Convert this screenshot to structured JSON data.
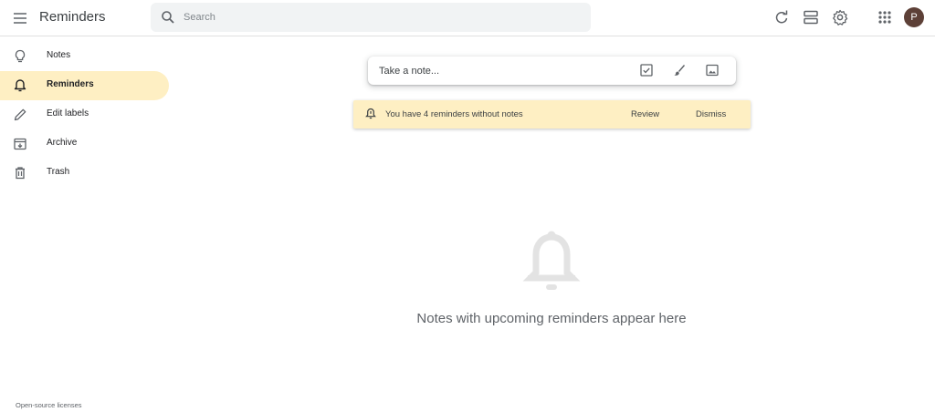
{
  "header": {
    "title": "Reminders",
    "search_placeholder": "Search",
    "avatar_initial": "P"
  },
  "sidebar": {
    "items": [
      {
        "label": "Notes",
        "icon": "lightbulb-icon",
        "active": false
      },
      {
        "label": "Reminders",
        "icon": "bell-icon",
        "active": true
      },
      {
        "label": "Edit labels",
        "icon": "pencil-icon",
        "active": false
      },
      {
        "label": "Archive",
        "icon": "archive-icon",
        "active": false
      },
      {
        "label": "Trash",
        "icon": "trash-icon",
        "active": false
      }
    ],
    "footer_link": "Open-source licenses"
  },
  "note_input": {
    "placeholder": "Take a note...",
    "icons": [
      "checkbox-icon",
      "brush-icon",
      "image-icon"
    ]
  },
  "banner": {
    "text": "You have 4 reminders without notes",
    "review_label": "Review",
    "dismiss_label": "Dismiss"
  },
  "empty_state": {
    "text": "Notes with upcoming reminders appear here",
    "icon": "bell-icon"
  },
  "colors": {
    "active_bg": "#feefc3",
    "banner_bg": "#feefc3",
    "avatar_bg": "#5d4037"
  }
}
